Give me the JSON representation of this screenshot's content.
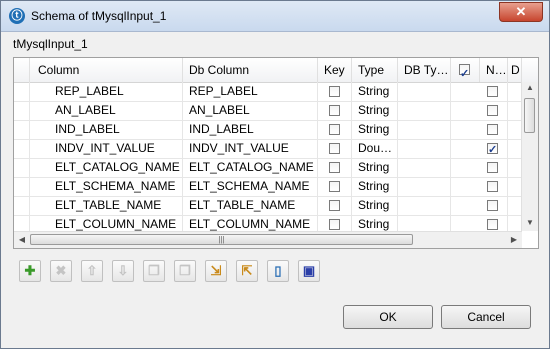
{
  "window": {
    "title": "Schema of tMysqlInput_1",
    "app_icon_glyph": "ⓣ",
    "close_glyph": "✕"
  },
  "component_label": "tMysqlInput_1",
  "columns": {
    "column": "Column",
    "db_column": "Db Column",
    "key": "Key",
    "type": "Type",
    "db_type": "DB Ty…",
    "nullable": "N…",
    "default": "D"
  },
  "rows": [
    {
      "column": "REP_LABEL",
      "db_column": "REP_LABEL",
      "type": "String",
      "key": false,
      "nullable": false
    },
    {
      "column": "AN_LABEL",
      "db_column": "AN_LABEL",
      "type": "String",
      "key": false,
      "nullable": false
    },
    {
      "column": "IND_LABEL",
      "db_column": "IND_LABEL",
      "type": "String",
      "key": false,
      "nullable": false
    },
    {
      "column": "INDV_INT_VALUE",
      "db_column": "INDV_INT_VALUE",
      "type": "Dou…",
      "key": false,
      "nullable": true
    },
    {
      "column": "ELT_CATALOG_NAME",
      "db_column": "ELT_CATALOG_NAME",
      "type": "String",
      "key": false,
      "nullable": false
    },
    {
      "column": "ELT_SCHEMA_NAME",
      "db_column": "ELT_SCHEMA_NAME",
      "type": "String",
      "key": false,
      "nullable": false
    },
    {
      "column": "ELT_TABLE_NAME",
      "db_column": "ELT_TABLE_NAME",
      "type": "String",
      "key": false,
      "nullable": false
    },
    {
      "column": "ELT_COLUMN_NAME",
      "db_column": "ELT_COLUMN_NAME",
      "type": "String",
      "key": false,
      "nullable": false
    }
  ],
  "toolbar": {
    "add_glyph": "✚",
    "remove_glyph": "✖",
    "up_glyph": "⇧",
    "down_glyph": "⇩",
    "copy_glyph": "❐",
    "paste_glyph": "❒",
    "import_glyph": "⇲",
    "export_glyph": "⇱",
    "guess_glyph": "▯",
    "save_glyph": "▣"
  },
  "buttons": {
    "ok": "OK",
    "cancel": "Cancel"
  },
  "colors": {
    "accent": "#1f6fb5",
    "close": "#c7452e",
    "add": "#3a9a2a",
    "save": "#2b3fa8"
  }
}
